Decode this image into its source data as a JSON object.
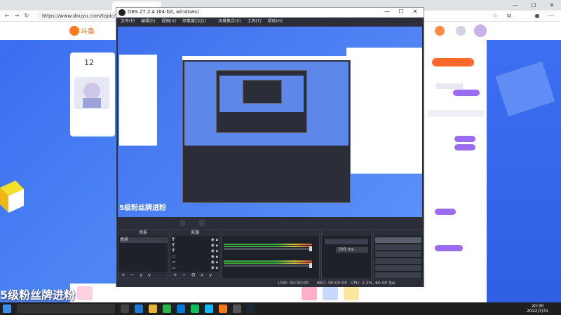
{
  "browser": {
    "tabs": [
      {
        "label": ""
      },
      {
        "label": ""
      },
      {
        "label": ""
      },
      {
        "label": ""
      }
    ],
    "url": "https://www.douyu.com/topic/mcdyj",
    "minimize": "—",
    "maximize": "☐",
    "close": "✕"
  },
  "site": {
    "logo_text": "斗鱼",
    "room_count": "12",
    "banner_text": "5级粉丝牌进粉",
    "chat_lines": [
      {
        "text": "",
        "tone": "red"
      },
      {
        "text": "",
        "tone": "red"
      },
      {
        "text": "",
        "tone": "red"
      },
      {
        "text": "",
        "tone": "black"
      },
      {
        "text": "",
        "tone": "black"
      }
    ]
  },
  "obs": {
    "title": "OBS 27.2.4 (64-bit, windows)",
    "menu": [
      "文件(F)",
      "编辑(E)",
      "视图(V)",
      "停靠窗口(D)",
      "",
      "场景集合(S)",
      "工具(T)",
      "帮助(H)"
    ],
    "toolbar_label": "",
    "toolbar_buttons": [
      "",
      ""
    ],
    "docks": {
      "scenes": {
        "title": "场景",
        "items": [
          "场景"
        ]
      },
      "sources": {
        "title": "来源",
        "items": [
          {
            "icon": "T",
            "label": ""
          },
          {
            "icon": "T",
            "label": ""
          },
          {
            "icon": "T",
            "label": ""
          },
          {
            "icon": "▭",
            "label": ""
          },
          {
            "icon": "▭",
            "label": ""
          },
          {
            "icon": "▭",
            "label": ""
          }
        ]
      },
      "mixer": {
        "title": "",
        "channels": [
          {
            "name": "",
            "db": ""
          },
          {
            "name": "",
            "db": ""
          }
        ]
      },
      "transitions": {
        "title": "",
        "type": "",
        "duration_label": "",
        "duration_value": "300 ms"
      },
      "controls": {
        "title": "",
        "buttons": [
          "",
          "",
          "",
          "",
          "",
          ""
        ]
      }
    },
    "status": {
      "live": "LIVE: 00:00:00",
      "rec": "REC: 00:00:00",
      "cpu": "CPU: 2.2%, 60.00 fps"
    }
  },
  "taskbar": {
    "search_placeholder": "",
    "time": "20:30",
    "date": "2022/7/31",
    "weather": ""
  }
}
